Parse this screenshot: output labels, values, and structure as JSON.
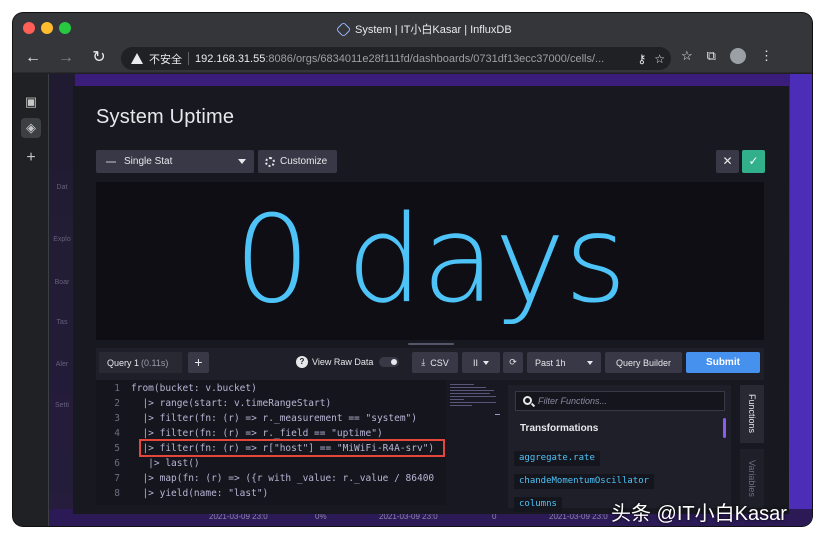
{
  "browser": {
    "tab_title": "System | IT小白Kasar | InfluxDB",
    "insecure_label": "不安全",
    "url_host": "192.168.31.55",
    "url_path": ":8086/orgs/6834011e28f111fd/dashboards/0731df13ecc37000/cells/...",
    "icons": [
      "back-icon",
      "forward-icon",
      "reload-icon",
      "warning-icon",
      "key-icon",
      "bookmark-star-icon",
      "extensions-icon",
      "reading-list-icon",
      "profile-icon",
      "menu-icon"
    ]
  },
  "sidebar_nav": {
    "items": [
      "Dat",
      "Explo",
      "Boar",
      "Tas",
      "Aler",
      "Setti"
    ]
  },
  "background_axis": {
    "labels": [
      "2021-03-09 23:0",
      "0%",
      "2021-03-09 23:0",
      "0",
      "2021-03-09 23:0"
    ]
  },
  "dialog": {
    "title": "System Uptime",
    "viz_type": "Single Stat",
    "customize_label": "Customize",
    "close_label": "✕",
    "confirm_label": "✓"
  },
  "stat": {
    "value": "0 days",
    "color": "#4ec3f7"
  },
  "query_bar": {
    "tab_label": "Query 1",
    "tab_time": "(0.11s)",
    "add_label": "+",
    "raw_data_label": "View Raw Data",
    "csv_label": "CSV",
    "pause_label": "II",
    "time_range": "Past 1h",
    "builder_label": "Query Builder",
    "submit_label": "Submit"
  },
  "editor": {
    "lines": [
      {
        "n": "1",
        "text": "from(bucket: v.bucket)"
      },
      {
        "n": "2",
        "text": "  |> range(start: v.timeRangeStart)"
      },
      {
        "n": "3",
        "text": "  |> filter(fn: (r) => r._measurement == \"system\")"
      },
      {
        "n": "4",
        "text": "  |> filter(fn: (r) => r._field == \"uptime\")"
      },
      {
        "n": "5",
        "text": "  |> filter(fn: (r) => r[\"host\"] == \"MiWiFi-R4A-srv\")"
      },
      {
        "n": "6",
        "text": "   |> last()"
      },
      {
        "n": "7",
        "text": "  |> map(fn: (r) => ({r with _value: r._value / 86400"
      },
      {
        "n": "8",
        "text": "  |> yield(name: \"last\")"
      }
    ],
    "highlight_color": "#e4473a"
  },
  "functions_panel": {
    "search_placeholder": "Filter Functions...",
    "heading": "Transformations",
    "items": [
      "aggregate.rate",
      "chandeMomentumOscillator",
      "columns"
    ],
    "tabs": [
      "Functions",
      "Variables"
    ]
  },
  "watermark": "头条 @IT小白Kasar"
}
